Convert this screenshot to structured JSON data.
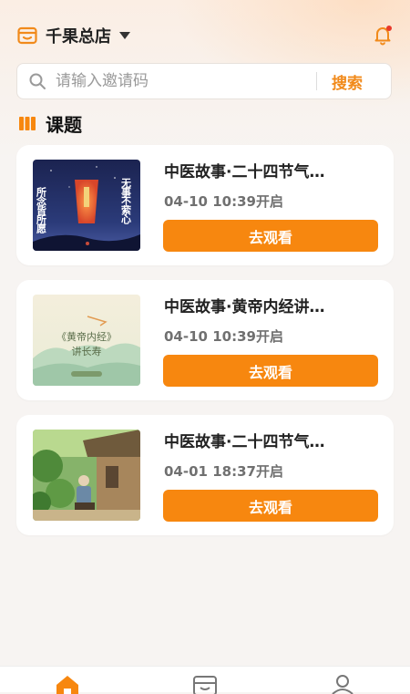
{
  "header": {
    "store_name": "千果总店",
    "store_icon": "store-icon",
    "dropdown_icon": "caret-down-icon",
    "notification_icon": "bell-icon",
    "notification_dot": true
  },
  "search": {
    "placeholder": "请输入邀请码",
    "value": "",
    "button_label": "搜索",
    "icon": "search-icon"
  },
  "section": {
    "title": "课题",
    "icon": "books-icon"
  },
  "courses": [
    {
      "title": "中医故事·二十四节气…",
      "time": "04-10 10:39开启",
      "button": "去观看",
      "thumbnail_text": [
        "所念皆所愿",
        "无事不萦心"
      ]
    },
    {
      "title": "中医故事·黄帝内经讲…",
      "time": "04-10 10:39开启",
      "button": "去观看",
      "thumbnail_text": [
        "《黄帝内经》",
        "讲长寿"
      ]
    },
    {
      "title": "中医故事·二十四节气…",
      "time": "04-01 18:37开启",
      "button": "去观看",
      "thumbnail_text": []
    }
  ],
  "tabbar": {
    "items": [
      {
        "icon": "home-icon",
        "active": true
      },
      {
        "icon": "shop-icon",
        "active": false
      },
      {
        "icon": "user-icon",
        "active": false
      }
    ]
  },
  "colors": {
    "accent": "#f7870f",
    "accent_text": "#f18a1b",
    "background": "#f7f4f2",
    "card": "#ffffff"
  }
}
